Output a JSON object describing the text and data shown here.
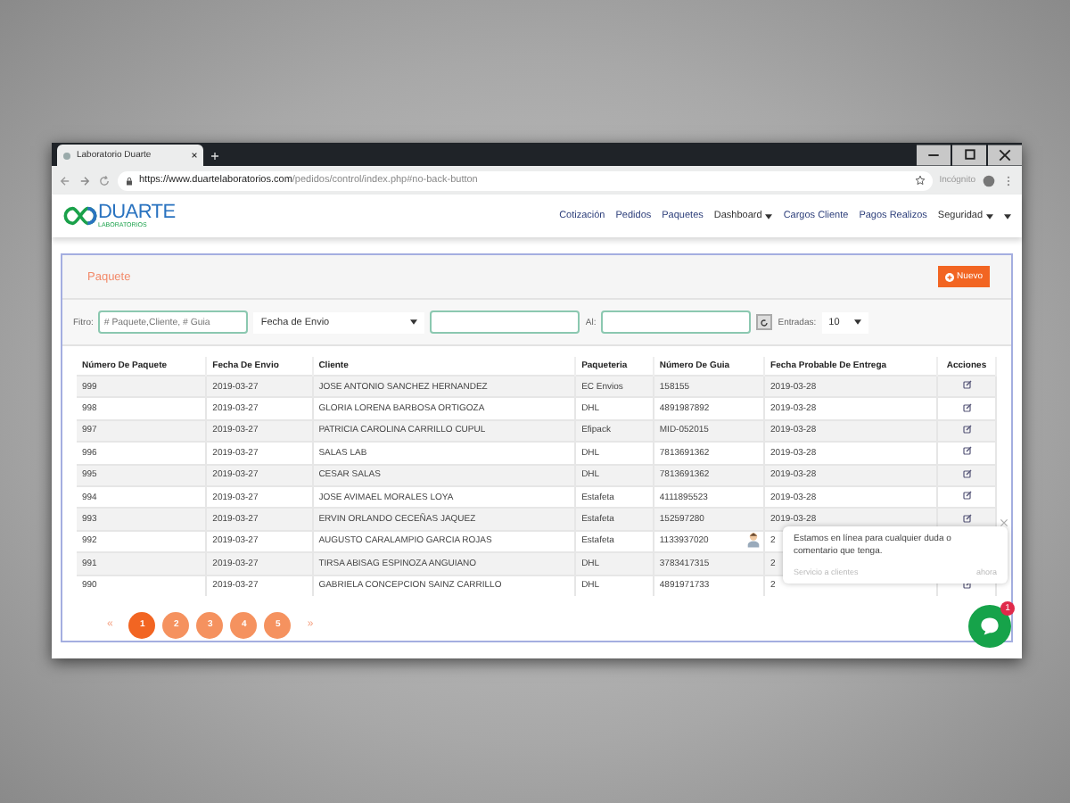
{
  "browser": {
    "tab_title": "Laboratorio Duarte",
    "url_host": "https://www.duartelaboratorios.com",
    "url_path": "/pedidos/control/index.php#no-back-button",
    "profile": "Incógnito"
  },
  "brand": {
    "name": "DUARTE",
    "tagline": "LABORATORIOS"
  },
  "nav": [
    {
      "label": "Cotización",
      "dropdown": false
    },
    {
      "label": "Pedidos",
      "dropdown": false
    },
    {
      "label": "Paquetes",
      "dropdown": false
    },
    {
      "label": "Dashboard",
      "dropdown": true
    },
    {
      "label": "Cargos Cliente",
      "dropdown": false
    },
    {
      "label": "Pagos Realizos",
      "dropdown": false
    },
    {
      "label": "Seguridad",
      "dropdown": true
    }
  ],
  "panel": {
    "title": "Paquete",
    "new_button": "Nuevo"
  },
  "filters": {
    "filter_label": "Fitro:",
    "search_placeholder": "# Paquete,Cliente, # Guia",
    "date_type": "Fecha de Envio",
    "to_label": "Al:",
    "entries_label": "Entradas:",
    "entries_value": "10"
  },
  "table": {
    "columns": [
      "Número De Paquete",
      "Fecha De Envio",
      "Cliente",
      "Paqueteria",
      "Número De Guia",
      "Fecha Probable De Entrega",
      "Acciones"
    ],
    "rows": [
      {
        "cells": [
          "999",
          "2019-03-27",
          "JOSE ANTONIO SANCHEZ HERNANDEZ",
          "EC Envios",
          "158155",
          "2019-03-28"
        ]
      },
      {
        "cells": [
          "998",
          "2019-03-27",
          "GLORIA LORENA BARBOSA ORTIGOZA",
          "DHL",
          "4891987892",
          "2019-03-28"
        ]
      },
      {
        "cells": [
          "997",
          "2019-03-27",
          "PATRICIA CAROLINA CARRILLO CUPUL",
          "Efipack",
          "MID-052015",
          "2019-03-28"
        ]
      },
      {
        "cells": [
          "996",
          "2019-03-27",
          "SALAS LAB",
          "DHL",
          "7813691362",
          "2019-03-28"
        ]
      },
      {
        "cells": [
          "995",
          "2019-03-27",
          "CESAR SALAS",
          "DHL",
          "7813691362",
          "2019-03-28"
        ]
      },
      {
        "cells": [
          "994",
          "2019-03-27",
          "JOSE AVIMAEL MORALES LOYA",
          "Estafeta",
          "4111895523",
          "2019-03-28"
        ]
      },
      {
        "cells": [
          "993",
          "2019-03-27",
          "ERVIN ORLANDO CECEÑAS JAQUEZ",
          "Estafeta",
          "152597280",
          "2019-03-28"
        ]
      },
      {
        "cells": [
          "992",
          "2019-03-27",
          "AUGUSTO CARALAMPIO GARCIA ROJAS",
          "Estafeta",
          "1133937020",
          "2"
        ]
      },
      {
        "cells": [
          "991",
          "2019-03-27",
          "TIRSA ABISAG ESPINOZA ANGUIANO",
          "DHL",
          "3783417315",
          "2"
        ]
      },
      {
        "cells": [
          "990",
          "2019-03-27",
          "GABRIELA CONCEPCION SAINZ CARRILLO",
          "DHL",
          "4891971733",
          "2"
        ]
      }
    ]
  },
  "pagination": {
    "prev": "«",
    "next": "»",
    "pages": [
      {
        "label": "1",
        "selected": true
      },
      {
        "label": "2",
        "selected": false
      },
      {
        "label": "3",
        "selected": false
      },
      {
        "label": "4",
        "selected": false
      },
      {
        "label": "5",
        "selected": false
      }
    ]
  },
  "chat": {
    "message": "Estamos en línea para cualquier duda o comentario que tenga.",
    "sender": "Servicio a clientes",
    "time": "ahora",
    "badge": "1"
  }
}
